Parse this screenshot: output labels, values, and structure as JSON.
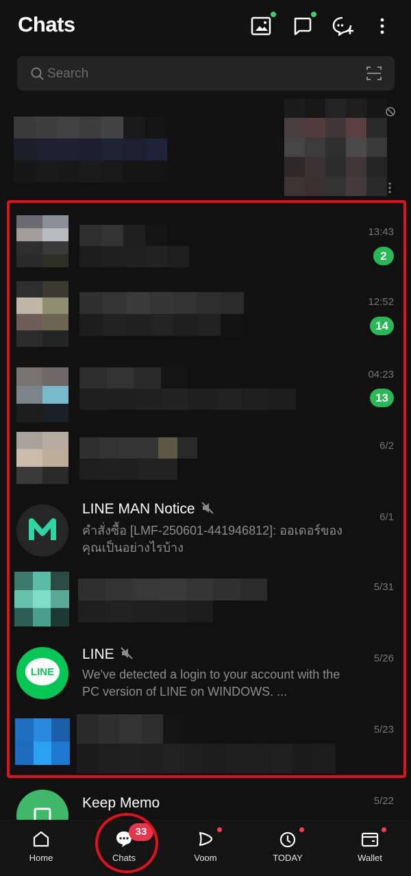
{
  "header": {
    "title": "Chats",
    "icons": [
      "image-add-icon",
      "square-chat-icon",
      "new-chat-icon",
      "more-vertical-icon"
    ]
  },
  "search": {
    "placeholder": "Search",
    "scan_icon": "qr-scan-icon"
  },
  "chats": [
    {
      "name": "",
      "message": "",
      "time": "13:43",
      "unread": "2",
      "avatar": "pixelated",
      "blurred": true
    },
    {
      "name": "",
      "message": "",
      "time": "12:52",
      "unread": "14",
      "avatar": "pixelated",
      "blurred": true
    },
    {
      "name": "",
      "message": "",
      "time": "04:23",
      "unread": "13",
      "avatar": "pixelated",
      "blurred": true
    },
    {
      "name": "",
      "message": "",
      "time": "6/2",
      "unread": "",
      "avatar": "pixelated",
      "blurred": true
    },
    {
      "name": "LINE MAN Notice",
      "message": "คำสั่งซื้อ [LMF-250601-441946812]: ออเดอร์ของคุณเป็นอย่างไรบ้าง",
      "time": "6/1",
      "unread": "",
      "muted": true,
      "avatar": "line-man-logo"
    },
    {
      "name": "",
      "message": "",
      "time": "5/31",
      "unread": "",
      "avatar": "pixelated",
      "blurred": true
    },
    {
      "name": "LINE",
      "message": "We've detected a login to your account with the PC version of LINE on WINDOWS. ...",
      "time": "5/26",
      "unread": "",
      "muted": true,
      "avatar": "line-logo",
      "avatar_text": "LINE"
    },
    {
      "name": "",
      "message": "",
      "time": "5/23",
      "unread": "",
      "avatar": "pixelated",
      "blurred": true
    },
    {
      "name": "Keep Memo",
      "message": "",
      "time": "5/22",
      "unread": "",
      "avatar": "keep-memo-icon"
    }
  ],
  "bottom_nav": [
    {
      "label": "Home",
      "icon": "home-icon",
      "dot": false
    },
    {
      "label": "Chats",
      "icon": "chat-bubble-icon",
      "badge": "33",
      "active": true
    },
    {
      "label": "Voom",
      "icon": "voom-play-icon",
      "dot": true
    },
    {
      "label": "TODAY",
      "icon": "today-icon",
      "dot": true
    },
    {
      "label": "Wallet",
      "icon": "wallet-icon",
      "dot": true
    }
  ],
  "colors": {
    "background": "#111111",
    "unread_badge": "#27b953",
    "nav_badge": "#e5374c",
    "highlight_annotation": "#e0121a",
    "line_green": "#06c755"
  }
}
